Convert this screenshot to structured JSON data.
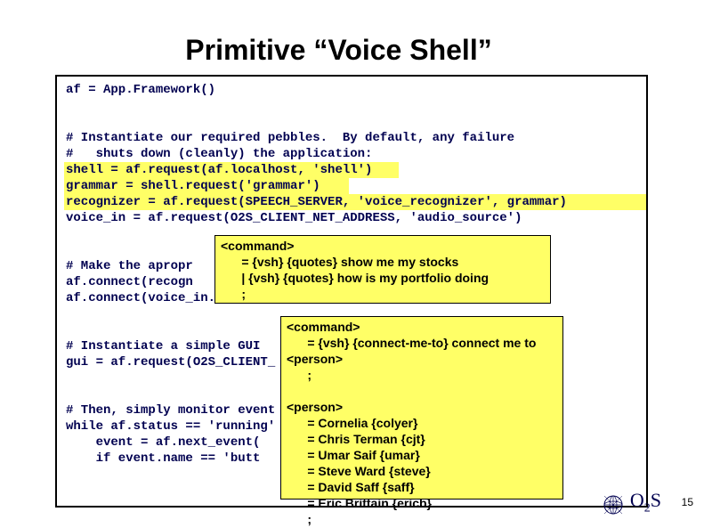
{
  "title": "Primitive “Voice Shell”",
  "code": "af = App.Framework()\n\n\n# Instantiate our required pebbles.  By default, any failure\n#   shuts down (cleanly) the application:\nshell = af.request(af.localhost, 'shell')\ngrammar = shell.request('grammar')\nrecognizer = af.request(SPEECH_SERVER, 'voice_recognizer', grammar)\nvoice_in = af.request(O2S_CLIENT_NET_ADDRESS, 'audio_source')\n\n\n# Make the apropr\naf.connect(recogn\naf.connect(voice_in.output,\n\n\n# Instantiate a simple GUI\ngui = af.request(O2S_CLIENT_\n\n\n# Then, simply monitor event\nwhile af.status == 'running'\n    event = af.next_event(\n    if event.name == 'butt",
  "overlay1": "<command>\n      = {vsh} {quotes} show me my stocks\n      | {vsh} {quotes} how is my portfolio doing\n      ;",
  "overlay2": "<command>\n      = {vsh} {connect-me-to} connect me to\n<person>\n      ;\n\n<person>\n      = Cornelia {colyer}\n      = Chris Terman {cjt}\n      = Umar Saif {umar}\n      = Steve Ward {steve}\n      = David Saff {saff}\n      = Eric Brittain {ericb}\n      ;",
  "footer": {
    "logo_O": "O",
    "logo_sub": "2",
    "logo_S": "S",
    "page": "15"
  }
}
